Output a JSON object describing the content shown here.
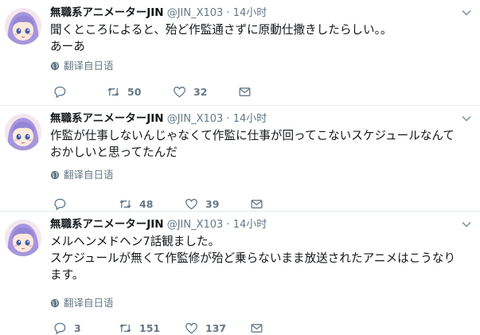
{
  "tweets": [
    {
      "name": "無職系アニメーターJIN",
      "handle": "@JIN_X103",
      "dot": "·",
      "time": "14小时",
      "lines": [
        "聞くところによると、殆ど作監通さずに原動仕撒きしたらしい。。",
        "あーあ"
      ],
      "translate": "翻译自日语",
      "reply_count": "",
      "retweet_count": "50",
      "like_count": "32"
    },
    {
      "name": "無職系アニメーターJIN",
      "handle": "@JIN_X103",
      "dot": "·",
      "time": "14小时",
      "lines": [
        "作監が仕事しないんじゃなくて作監に仕事が回ってこないスケジュールなんて",
        "おかしいと思ってたんだ"
      ],
      "translate": "翻译自日语",
      "reply_count": "",
      "retweet_count": "48",
      "like_count": "39"
    },
    {
      "name": "無職系アニメーターJIN",
      "handle": "@JIN_X103",
      "dot": "·",
      "time": "14小时",
      "lines": [
        "メルヘンメドヘン7話観ました。",
        "スケジュールが無くて作監修が殆ど乗らないまま放送されたアニメはこうなり",
        "ます。"
      ],
      "translate": "翻译自日语",
      "reply_count": "3",
      "retweet_count": "151",
      "like_count": "137"
    }
  ],
  "icons": {
    "avatar": "anime-avatar",
    "caret": "chevron-down-icon",
    "translate": "globe-icon",
    "reply": "reply-icon",
    "retweet": "retweet-icon",
    "like": "heart-icon",
    "message": "envelope-icon"
  },
  "colors": {
    "text": "#14171a",
    "muted": "#657786",
    "divider": "#e6ecf0",
    "avatar_hair": "#9b8fd6"
  }
}
